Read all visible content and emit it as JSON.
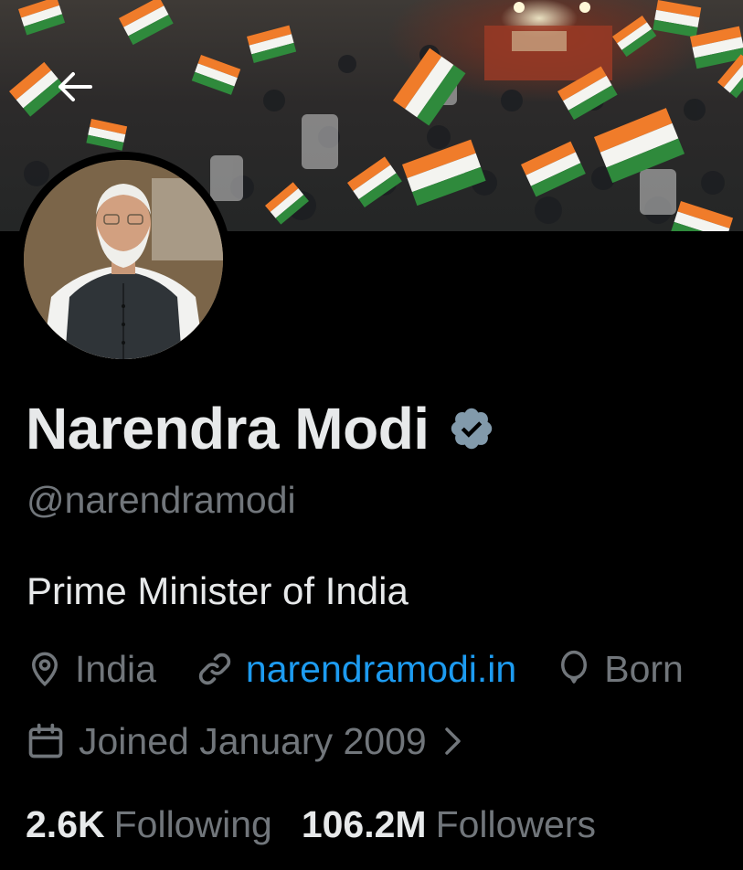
{
  "profile": {
    "display_name": "Narendra Modi",
    "handle": "@narendramodi",
    "bio": "Prime Minister of India",
    "location": "India",
    "website": "narendramodi.in",
    "birthday_label": "Born",
    "joined": "Joined January 2009",
    "verified": true
  },
  "stats": {
    "following_count": "2.6K",
    "following_label": "Following",
    "followers_count": "106.2M",
    "followers_label": "Followers"
  },
  "icons": {
    "back": "arrow-left-icon",
    "verified": "verified-badge-icon",
    "location": "location-pin-icon",
    "link": "link-icon",
    "birthday": "balloon-icon",
    "calendar": "calendar-icon",
    "chevron": "chevron-right-icon"
  },
  "colors": {
    "background": "#000000",
    "text_primary": "#e7e9ea",
    "text_secondary": "#71767b",
    "link": "#1d9bf0",
    "badge": "#829aab"
  }
}
